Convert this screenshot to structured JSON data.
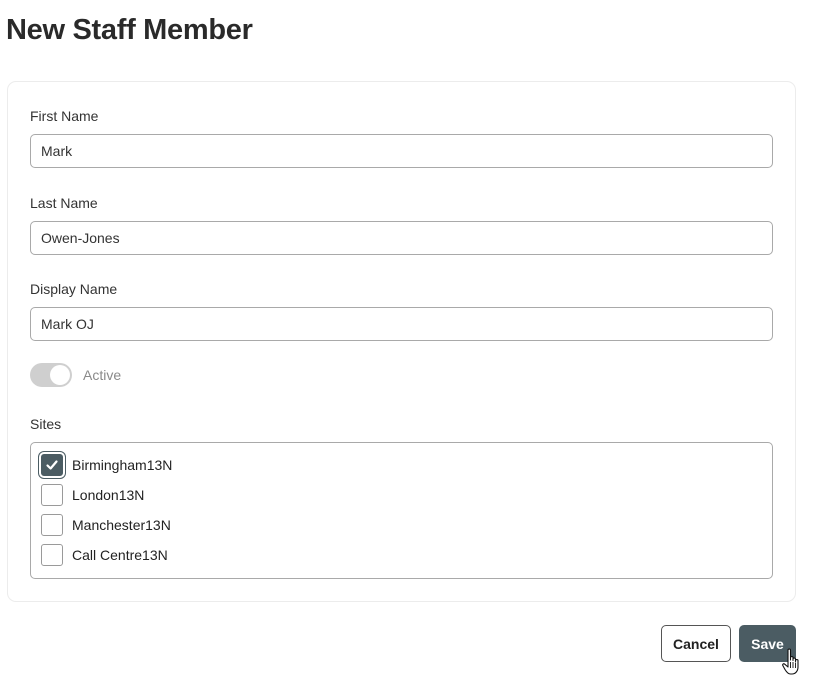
{
  "page": {
    "title": "New Staff Member"
  },
  "form": {
    "first_name": {
      "label": "First Name",
      "value": "Mark"
    },
    "last_name": {
      "label": "Last Name",
      "value": "Owen-Jones"
    },
    "display_name": {
      "label": "Display Name",
      "value": "Mark OJ"
    },
    "active": {
      "label": "Active",
      "enabled": true,
      "disabled_appearance": true
    },
    "sites": {
      "label": "Sites",
      "items": [
        {
          "label": "Birmingham13N",
          "checked": true
        },
        {
          "label": "London13N",
          "checked": false
        },
        {
          "label": "Manchester13N",
          "checked": false
        },
        {
          "label": "Call Centre13N",
          "checked": false
        }
      ]
    }
  },
  "actions": {
    "cancel_label": "Cancel",
    "save_label": "Save"
  },
  "colors": {
    "accent": "#4b5c63",
    "toggle_track": "#cfcfcf",
    "input_border": "#a9a9a9"
  },
  "icons": {
    "checkbox_check": "checkmark-icon",
    "cursor": "hand-pointer-icon"
  }
}
